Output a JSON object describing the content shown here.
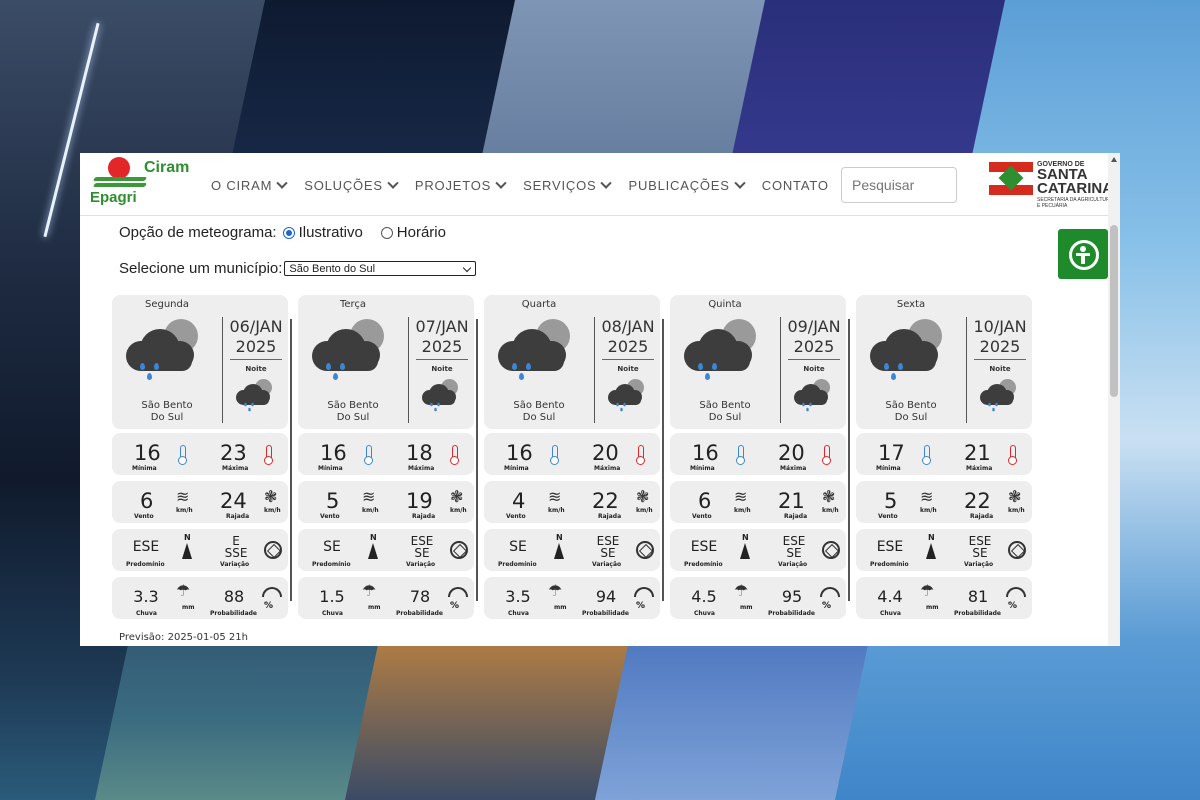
{
  "header": {
    "logo_top": "Ciram",
    "logo_bottom": "Epagri",
    "nav": [
      {
        "label": "O CIRAM",
        "dropdown": true
      },
      {
        "label": "SOLUÇÕES",
        "dropdown": true
      },
      {
        "label": "PROJETOS",
        "dropdown": true
      },
      {
        "label": "SERVIÇOS",
        "dropdown": true
      },
      {
        "label": "PUBLICAÇÕES",
        "dropdown": true
      },
      {
        "label": "CONTATO",
        "dropdown": false
      }
    ],
    "search_placeholder": "Pesquisar",
    "gov_line1": "GOVERNO DE",
    "gov_line2": "SANTA CATARINA",
    "gov_line3": "SECRETARIA DA AGRICULTURA E PECUÁRIA"
  },
  "options": {
    "label": "Opção de meteograma:",
    "illustrative": "Ilustrativo",
    "hourly": "Horário",
    "selected": "Ilustrativo"
  },
  "municipio": {
    "label": "Selecione um município:",
    "selected": "São Bento do Sul"
  },
  "labels": {
    "night": "Noite",
    "city_line1": "São Bento",
    "city_line2": "Do Sul",
    "min": "Mínima",
    "max": "Máxima",
    "wind": "Vento",
    "gust": "Rajada",
    "kmh": "km/h",
    "predominant": "Predomínio",
    "variation": "Variação",
    "rain": "Chuva",
    "mm": "mm",
    "probability": "Probabilidade",
    "north": "N"
  },
  "days": [
    {
      "day": "Segunda",
      "date1": "06/JAN",
      "date2": "2025",
      "min": "16",
      "max": "23",
      "wind": "6",
      "gust": "24",
      "dir": "ESE",
      "var1": "E",
      "var2": "SSE",
      "rain": "3.3",
      "prob": "88"
    },
    {
      "day": "Terça",
      "date1": "07/JAN",
      "date2": "2025",
      "min": "16",
      "max": "18",
      "wind": "5",
      "gust": "19",
      "dir": "SE",
      "var1": "ESE",
      "var2": "SE",
      "rain": "1.5",
      "prob": "78"
    },
    {
      "day": "Quarta",
      "date1": "08/JAN",
      "date2": "2025",
      "min": "16",
      "max": "20",
      "wind": "4",
      "gust": "22",
      "dir": "SE",
      "var1": "ESE",
      "var2": "SE",
      "rain": "3.5",
      "prob": "94"
    },
    {
      "day": "Quinta",
      "date1": "09/JAN",
      "date2": "2025",
      "min": "16",
      "max": "20",
      "wind": "6",
      "gust": "21",
      "dir": "ESE",
      "var1": "ESE",
      "var2": "SE",
      "rain": "4.5",
      "prob": "95"
    },
    {
      "day": "Sexta",
      "date1": "10/JAN",
      "date2": "2025",
      "min": "17",
      "max": "21",
      "wind": "5",
      "gust": "22",
      "dir": "ESE",
      "var1": "ESE",
      "var2": "SE",
      "rain": "4.4",
      "prob": "81"
    }
  ],
  "forecast_time": "Previsão: 2025-01-05 21h",
  "colors": {
    "cold": "#3b86d6",
    "hot": "#e3262a",
    "accent": "#1e8a2b"
  }
}
